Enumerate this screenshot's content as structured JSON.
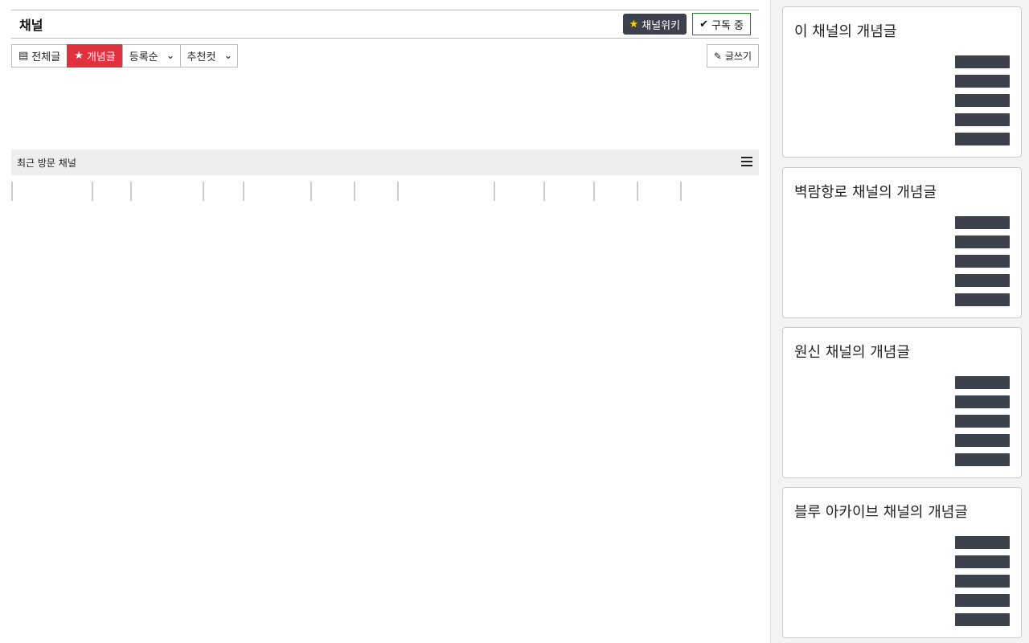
{
  "channel": {
    "name": "채널",
    "description": "",
    "wiki_label": "채널위키",
    "subscribe_label": "구독 중"
  },
  "toolbar": {
    "all_label": "전체글",
    "best_label": "개념글",
    "sort_label": "등록순",
    "rec_label": "추천컷",
    "write_label": "글쓰기"
  },
  "recent": {
    "label": "최근 방문 채널",
    "channels": [
      "",
      "",
      "",
      "",
      "",
      "",
      "",
      "",
      "",
      "",
      "",
      "",
      "",
      ""
    ]
  },
  "columns": [
    "",
    "",
    "",
    "",
    "",
    ""
  ],
  "posts": [],
  "expand_label": "",
  "sidebar": [
    {
      "title": "이 채널의 개념글",
      "items": [
        {
          "t": "",
          "d": ""
        },
        {
          "t": "",
          "d": ""
        },
        {
          "t": "",
          "d": ""
        },
        {
          "t": "",
          "d": ""
        },
        {
          "t": "",
          "d": ""
        }
      ]
    },
    {
      "title": "벽람항로 채널의 개념글",
      "items": [
        {
          "t": "",
          "d": ""
        },
        {
          "t": "",
          "d": ""
        },
        {
          "t": "",
          "d": ""
        },
        {
          "t": "",
          "d": ""
        },
        {
          "t": "",
          "d": ""
        }
      ]
    },
    {
      "title": "원신 채널의 개념글",
      "items": [
        {
          "t": "",
          "d": ""
        },
        {
          "t": "",
          "d": ""
        },
        {
          "t": "",
          "d": ""
        },
        {
          "t": "",
          "d": ""
        },
        {
          "t": "",
          "d": ""
        }
      ]
    },
    {
      "title": "블루 아카이브 채널의 개념글",
      "items": [
        {
          "t": "",
          "d": ""
        },
        {
          "t": "",
          "d": ""
        },
        {
          "t": "",
          "d": ""
        },
        {
          "t": "",
          "d": ""
        },
        {
          "t": "",
          "d": ""
        }
      ]
    }
  ]
}
